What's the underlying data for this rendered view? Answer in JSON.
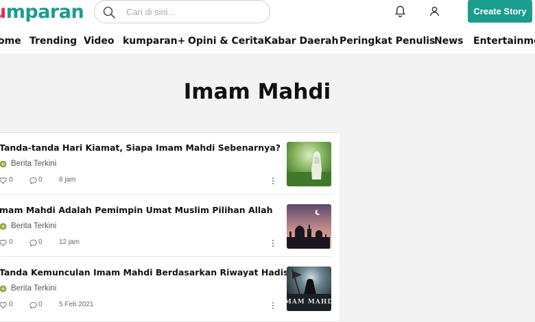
{
  "header": {
    "logo_main": "mparan",
    "logo_cut": "u",
    "search_placeholder": "Cari di sini...",
    "create_label": "Create Story",
    "icons": {
      "search": "search-icon",
      "notifications": "bell-icon",
      "account": "user-icon"
    },
    "colors": {
      "brand": "#1a9c8e",
      "logo_accent": "#e2304f"
    }
  },
  "nav": [
    "ome",
    "Trending",
    "Video",
    "kumparan+",
    "Opini & Cerita",
    "Kabar Daerah",
    "Peringkat Penulis",
    "News",
    "Entertainmen"
  ],
  "page": {
    "title": "Imam Mahdi"
  },
  "articles": [
    {
      "title": "Tanda-tanda Hari Kiamat, Siapa Imam Mahdi Sebenarnya?",
      "publisher": "Berita Terkini",
      "likes": "0",
      "comments": "0",
      "time": "8 jam"
    },
    {
      "title": "mam Mahdi Adalah Pemimpin Umat Muslim Pilihan Allah",
      "publisher": "Berita Terkini",
      "likes": "0",
      "comments": "0",
      "time": "12 jam"
    },
    {
      "title": "Tanda Kemunculan Imam Mahdi Berdasarkan Riwayat Hadist",
      "publisher": "Berita Terkini",
      "likes": "0",
      "comments": "0",
      "time": "5 Feb 2021",
      "thumb_text": "MAM MAHD"
    }
  ]
}
